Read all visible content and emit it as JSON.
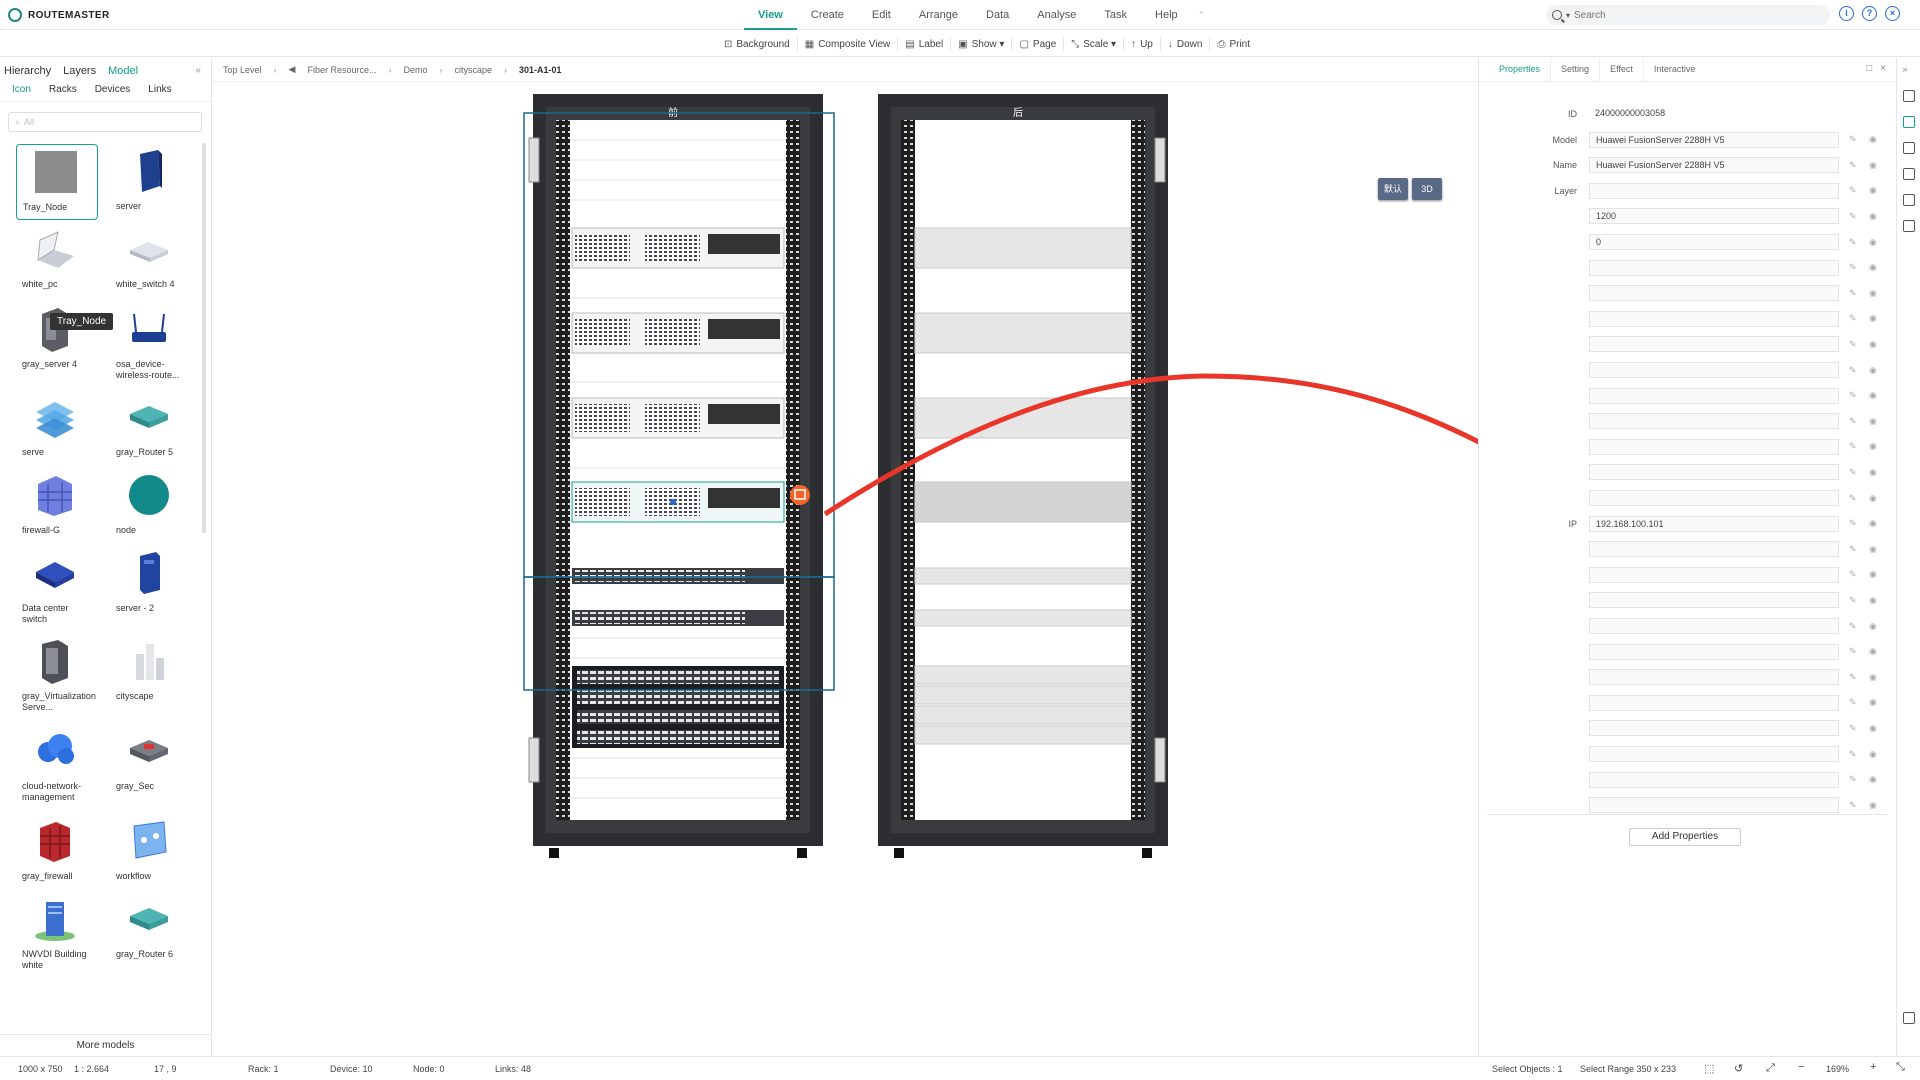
{
  "app": {
    "name": "ROUTEMASTER"
  },
  "menu": {
    "items": [
      "View",
      "Create",
      "Edit",
      "Arrange",
      "Data",
      "Analyse",
      "Task",
      "Help"
    ],
    "active": "View",
    "pin": "⌃"
  },
  "search": {
    "placeholder": "Search"
  },
  "toolbar": {
    "items": [
      {
        "icon": "background-icon",
        "label": "Background"
      },
      {
        "icon": "composite-view-icon",
        "label": "Composite View"
      },
      {
        "icon": "label-icon",
        "label": "Label"
      },
      {
        "icon": "show-icon",
        "label": "Show ▾"
      },
      {
        "icon": "page-icon",
        "label": "Page"
      },
      {
        "icon": "scale-icon",
        "label": "Scale ▾"
      },
      {
        "icon": "up-icon",
        "label": "Up"
      },
      {
        "icon": "down-icon",
        "label": "Down"
      },
      {
        "icon": "print-icon",
        "label": "Print"
      }
    ]
  },
  "left": {
    "tabs": [
      "Hierarchy",
      "Layers",
      "Model"
    ],
    "active_tab": "Model",
    "subtabs": [
      "Icon",
      "Racks",
      "Devices",
      "Links"
    ],
    "active_subtab": "Icon",
    "filter_placeholder": "All",
    "tooltip": "Tray_Node",
    "more": "More models",
    "items": [
      {
        "label": "Tray_Node",
        "icon": "tray-node-icon"
      },
      {
        "label": "server",
        "icon": "server-icon"
      },
      {
        "label": "white_pc",
        "icon": "laptop-icon"
      },
      {
        "label": "white_switch 4",
        "icon": "switch-icon"
      },
      {
        "label": "gray_server 4",
        "icon": "gray-server-icon"
      },
      {
        "label": "osa_device-wireless-route...",
        "icon": "wireless-router-icon"
      },
      {
        "label": "serve",
        "icon": "stack-icon"
      },
      {
        "label": "gray_Router 5",
        "icon": "router-icon"
      },
      {
        "label": "firewall-G",
        "icon": "firewall-icon"
      },
      {
        "label": "node",
        "icon": "node-icon"
      },
      {
        "label": "Data center switch",
        "icon": "dc-switch-icon"
      },
      {
        "label": "server - 2",
        "icon": "server2-icon"
      },
      {
        "label": "gray_Virtualization Serve...",
        "icon": "virtualization-server-icon"
      },
      {
        "label": "cityscape",
        "icon": "cityscape-icon"
      },
      {
        "label": "cloud-network-management",
        "icon": "cloud-network-icon"
      },
      {
        "label": "gray_Sec",
        "icon": "security-icon"
      },
      {
        "label": "gray_firewall",
        "icon": "gray-firewall-icon"
      },
      {
        "label": "workflow",
        "icon": "workflow-icon"
      },
      {
        "label": "NWVDI Building white",
        "icon": "building-icon"
      },
      {
        "label": "gray_Router 6",
        "icon": "router6-icon"
      }
    ]
  },
  "breadcrumb": {
    "items": [
      "Top Level",
      "Fiber Resource...",
      "Demo",
      "cityscape",
      "301-A1-01"
    ],
    "back_glyph": "◀"
  },
  "canvas": {
    "rack_front_title": "前",
    "rack_back_title": "后",
    "view_buttons": [
      "默认",
      "3D"
    ]
  },
  "right": {
    "tabs": [
      "Properties",
      "Setting",
      "Effect",
      "Interactive"
    ],
    "active_tab": "Properties",
    "properties": [
      {
        "label": "ID",
        "value": "24000000003058",
        "plain": true
      },
      {
        "label": "Model",
        "value": "Huawei FusionServer 2288H V5"
      },
      {
        "label": "Name",
        "value": "Huawei FusionServer 2288H V5"
      },
      {
        "label": "Layer",
        "value": ""
      },
      {
        "label": "",
        "value": "1200"
      },
      {
        "label": "",
        "value": "0"
      },
      {
        "label": "",
        "value": ""
      },
      {
        "label": "",
        "value": ""
      },
      {
        "label": "",
        "value": ""
      },
      {
        "label": "",
        "value": ""
      },
      {
        "label": "",
        "value": ""
      },
      {
        "label": "",
        "value": ""
      },
      {
        "label": "",
        "value": ""
      },
      {
        "label": "",
        "value": ""
      },
      {
        "label": "",
        "value": ""
      },
      {
        "label": "",
        "value": ""
      },
      {
        "label": "IP",
        "value": "192.168.100.101"
      },
      {
        "label": "",
        "value": ""
      },
      {
        "label": "",
        "value": ""
      },
      {
        "label": "",
        "value": ""
      },
      {
        "label": "",
        "value": ""
      },
      {
        "label": "",
        "value": ""
      },
      {
        "label": "",
        "value": ""
      },
      {
        "label": "",
        "value": ""
      },
      {
        "label": "",
        "value": ""
      },
      {
        "label": "",
        "value": ""
      },
      {
        "label": "",
        "value": ""
      },
      {
        "label": "",
        "value": ""
      }
    ],
    "add_button": "Add Properties"
  },
  "status": {
    "canvas_size": "1000 x 750",
    "ratio": "1 : 2.664",
    "coords": "17 , 9",
    "rack": "Rack: 1",
    "device": "Device: 10",
    "node": "Node: 0",
    "links": "Links: 48",
    "select_objects": "Select Objects :  1",
    "select_range": "Select Range   350 x 233",
    "zoom": "169%"
  },
  "colors": {
    "accent": "#14a08a",
    "arrow": "#e8372a"
  }
}
